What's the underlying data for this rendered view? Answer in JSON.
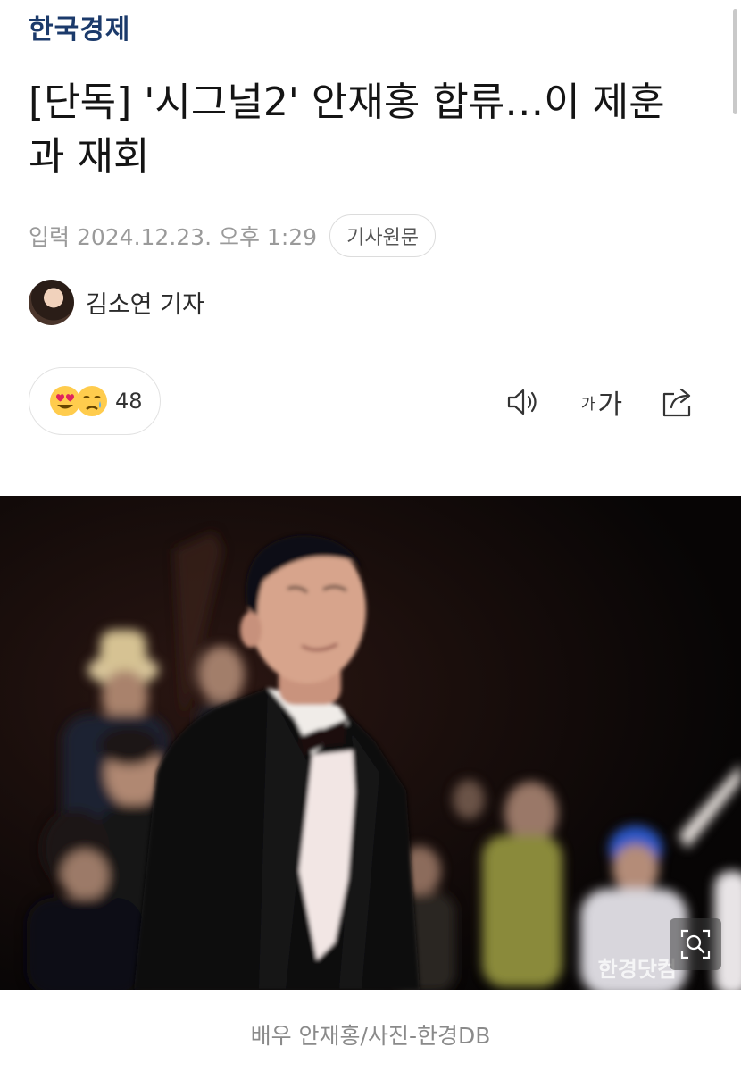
{
  "header": {
    "logo_text": "한국경제"
  },
  "article": {
    "headline": "[단독] '시그널2' 안재홍 합류…이 제훈과 재회",
    "published": "입력 2024.12.23. 오후 1:29",
    "original_button": "기사원문",
    "reporter": "김소연 기자"
  },
  "reactions": {
    "emojis": [
      "heart-eyes",
      "crying"
    ],
    "count": "48"
  },
  "toolbar": {
    "icons": [
      "speaker-icon",
      "font-size-icon",
      "share-icon"
    ],
    "font_small": "가",
    "font_large": "가"
  },
  "photo": {
    "watermark": "한경닷컴",
    "caption": "배우 안재홍/사진-한경DB"
  },
  "colors": {
    "logo": "#1b3a6b",
    "muted": "#9a9a9a",
    "border": "#e2e2e2"
  }
}
